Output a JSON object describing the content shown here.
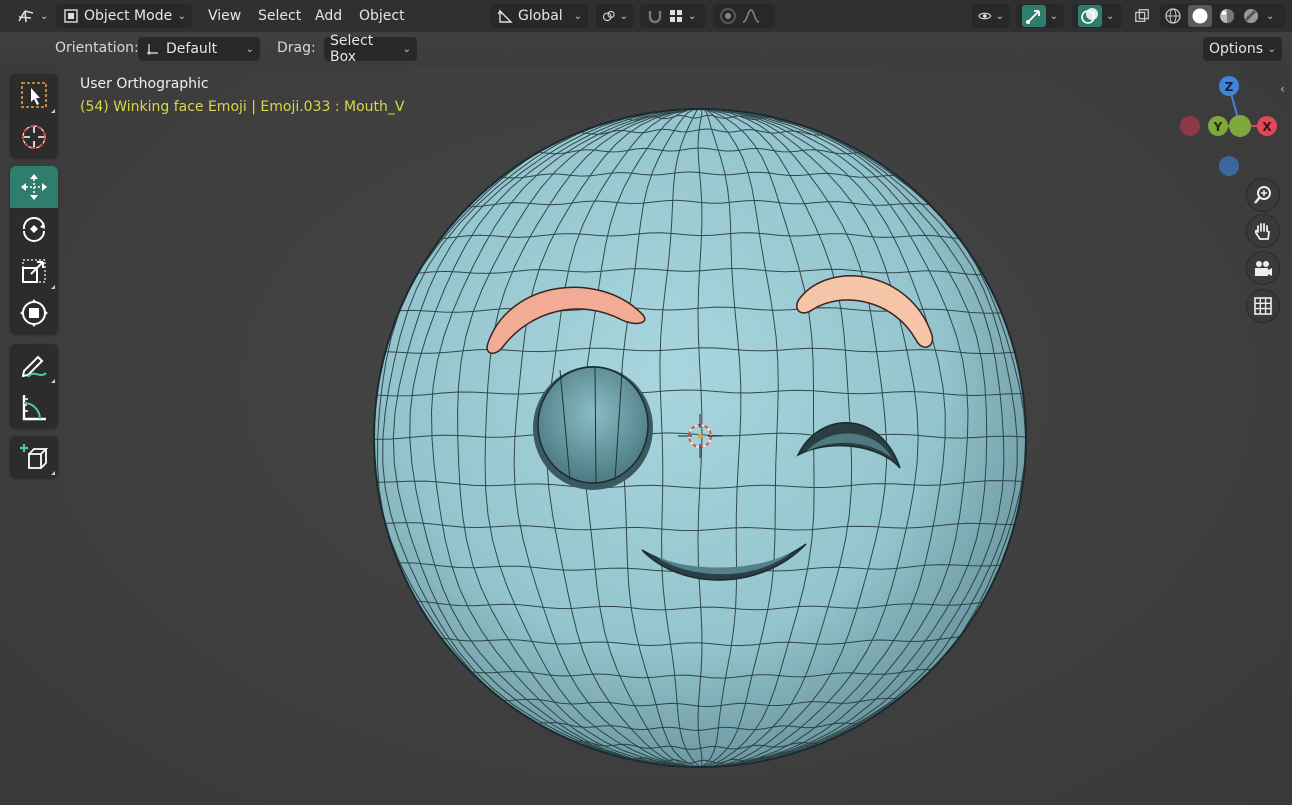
{
  "header": {
    "editor_type_icon": "axes-icon",
    "mode_label": "Object Mode",
    "menus": [
      "View",
      "Select",
      "Add",
      "Object"
    ],
    "transform_orientation_label": "Global",
    "options_label": "Options"
  },
  "subheader": {
    "orientation_label": "Orientation:",
    "orientation_value": "Default",
    "drag_label": "Drag:",
    "drag_value": "Select Box"
  },
  "viewport": {
    "view_name": "User Orthographic",
    "object_info": "(54) Winking face Emoji | Emoji.033 : Mouth_V",
    "object_info_color": "#d8d84a"
  },
  "gizmo": {
    "z_label": "Z",
    "y_label": "Y",
    "x_label": "X",
    "x_color": "#e0485a",
    "y_color": "#7ea83c",
    "z_color": "#3f84d8"
  },
  "toolbar": {
    "tools": [
      "select-box-icon",
      "cursor-icon",
      "move-icon",
      "rotate-icon",
      "scale-icon",
      "transform-icon",
      "annotate-icon",
      "measure-icon",
      "add-cube-icon"
    ],
    "active_tool": "move-icon",
    "active_color": "#2f7e6d"
  },
  "model": {
    "face_color": "#9ccad3",
    "brow_color": "#f2b09a"
  }
}
